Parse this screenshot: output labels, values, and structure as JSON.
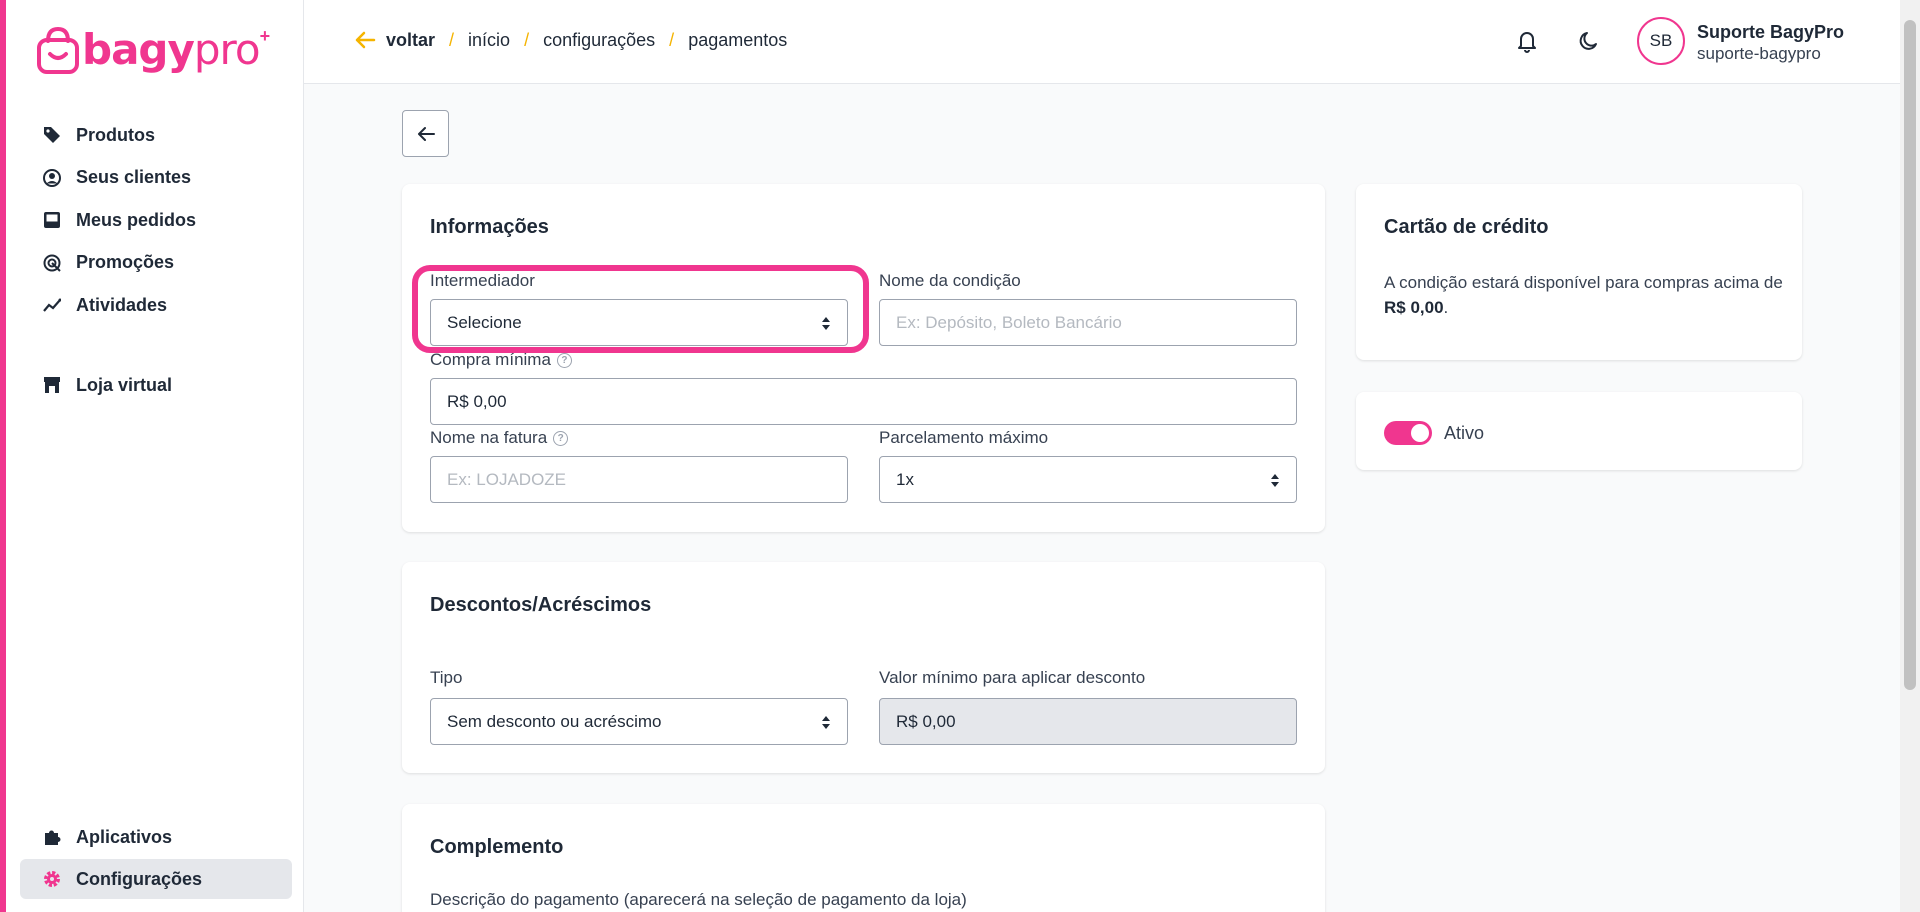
{
  "brand": {
    "name": "bagy",
    "suffix": "pro",
    "plus": "+",
    "accent": "#f0368f"
  },
  "sidebar": {
    "top_items": [
      {
        "label": "Produtos",
        "icon": "tag-icon"
      },
      {
        "label": "Seus clientes",
        "icon": "user-circle-icon"
      },
      {
        "label": "Meus pedidos",
        "icon": "inbox-icon"
      },
      {
        "label": "Promoções",
        "icon": "promotion-icon"
      },
      {
        "label": "Atividades",
        "icon": "activity-icon"
      }
    ],
    "store_item": {
      "label": "Loja virtual",
      "icon": "store-icon"
    },
    "bottom_items": [
      {
        "label": "Aplicativos",
        "icon": "puzzle-icon"
      },
      {
        "label": "Configurações",
        "icon": "gear-icon",
        "active": true
      }
    ]
  },
  "header": {
    "breadcrumb": [
      "voltar",
      "início",
      "configurações",
      "pagamentos"
    ],
    "separator": "/",
    "user": {
      "initials": "SB",
      "name": "Suporte BagyPro",
      "handle": "suporte-bagypro"
    }
  },
  "info_card": {
    "title": "Informações",
    "intermediador": {
      "label": "Intermediador",
      "value": "Selecione"
    },
    "nome_condicao": {
      "label": "Nome da condição",
      "placeholder": "Ex: Depósito, Boleto Bancário"
    },
    "compra_minima": {
      "label": "Compra mínima",
      "value": "R$ 0,00"
    },
    "nome_fatura": {
      "label": "Nome na fatura",
      "placeholder": "Ex: LOJADOZE"
    },
    "parcelamento": {
      "label": "Parcelamento máximo",
      "value": "1x"
    },
    "help_glyph": "?"
  },
  "discount_card": {
    "title": "Descontos/Acréscimos",
    "tipo": {
      "label": "Tipo",
      "value": "Sem desconto ou acréscimo"
    },
    "valor_minimo": {
      "label": "Valor mínimo para aplicar desconto",
      "value": "R$ 0,00"
    }
  },
  "complement_card": {
    "title": "Complemento",
    "descricao_label": "Descrição do pagamento (aparecerá na seleção de pagamento da loja)"
  },
  "credit_card": {
    "title": "Cartão de crédito",
    "desc_prefix": "A condição estará disponível para compras acima de ",
    "desc_value": "R$ 0,00",
    "desc_suffix": "."
  },
  "status_card": {
    "label": "Ativo",
    "active": true
  }
}
